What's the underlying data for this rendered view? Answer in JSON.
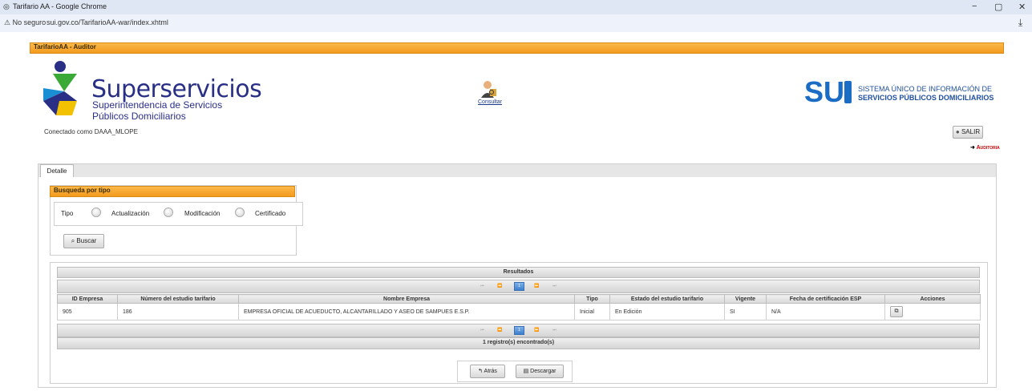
{
  "browser": {
    "window_title": "Tarifario AA - Google Chrome",
    "security_label": "No seguro",
    "url": "sui.gov.co/TarifarioAA-war/index.xhtml"
  },
  "app": {
    "header_title": "TarifarioAA - Auditor",
    "brand_name": "Superservicios",
    "brand_sub1": "Superintendencia de Servicios",
    "brand_sub2": "Públicos Domiciliarios",
    "connected_as": "Conectado como DAAA_MLOPE",
    "consultar_label": "Consultar",
    "sui_line1": "SISTEMA ÚNICO DE INFORMACIÓN DE",
    "sui_line2": "SERVICIOS PÚBLICOS DOMICILIARIOS",
    "salir_label": "SALIR",
    "auditoria_label": "Auditoria"
  },
  "tabs": [
    {
      "label": "Detalle",
      "active": true
    }
  ],
  "busqueda": {
    "title": "Busqueda por tipo",
    "tipo_label": "Tipo",
    "options": [
      "Actualización",
      "Modificación",
      "Certificado"
    ],
    "buscar_label": "Buscar"
  },
  "results": {
    "title": "Resultados",
    "page": "1",
    "columns": [
      "ID Empresa",
      "Número del estudio tarifario",
      "Nombre Empresa",
      "Tipo",
      "Estado del estudio tarifario",
      "Vigente",
      "Fecha de certificación ESP",
      "Acciones"
    ],
    "rows": [
      [
        "905",
        "186",
        "EMPRESA OFICIAL DE ACUEDUCTO, ALCANTARILLADO Y ASEO DE SAMPUES E.S.P.",
        "Inicial",
        "En Edición",
        "SI",
        "N/A"
      ]
    ],
    "footer": "1 registro(s) encontrado(s)"
  },
  "footer_buttons": {
    "atras": "Atrás",
    "descargar": "Descargar"
  },
  "colors": {
    "accent_orange": "#f39a1d",
    "brand_blue": "#2a2f86",
    "alert_red": "#cc0000"
  }
}
